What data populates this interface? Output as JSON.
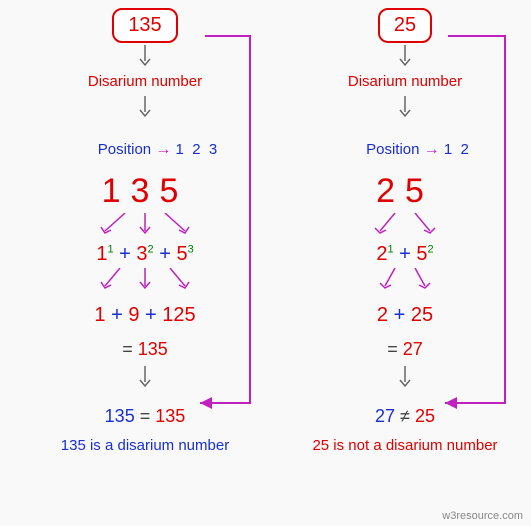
{
  "examples": [
    {
      "input": "135",
      "title": "Disarium number",
      "position_label": "Position",
      "positions": [
        "1",
        "2",
        "3"
      ],
      "digits": "135",
      "power_terms": [
        {
          "base": "1",
          "exp": "1"
        },
        {
          "base": "3",
          "exp": "2"
        },
        {
          "base": "5",
          "exp": "3"
        }
      ],
      "evaluated": [
        "1",
        "9",
        "125"
      ],
      "sum": "135",
      "compare_lhs": "135",
      "compare_op": "=",
      "compare_rhs": "135",
      "conclusion": "135 is a disarium number",
      "match": true
    },
    {
      "input": "25",
      "title": "Disarium number",
      "position_label": "Position",
      "positions": [
        "1",
        "2"
      ],
      "digits": "25",
      "power_terms": [
        {
          "base": "2",
          "exp": "1"
        },
        {
          "base": "5",
          "exp": "2"
        }
      ],
      "evaluated": [
        "2",
        "25"
      ],
      "sum": "27",
      "compare_lhs": "27",
      "compare_op": "≠",
      "compare_rhs": "25",
      "conclusion": "25 is not a disarium number",
      "match": false
    }
  ],
  "credit": "w3resource.com"
}
